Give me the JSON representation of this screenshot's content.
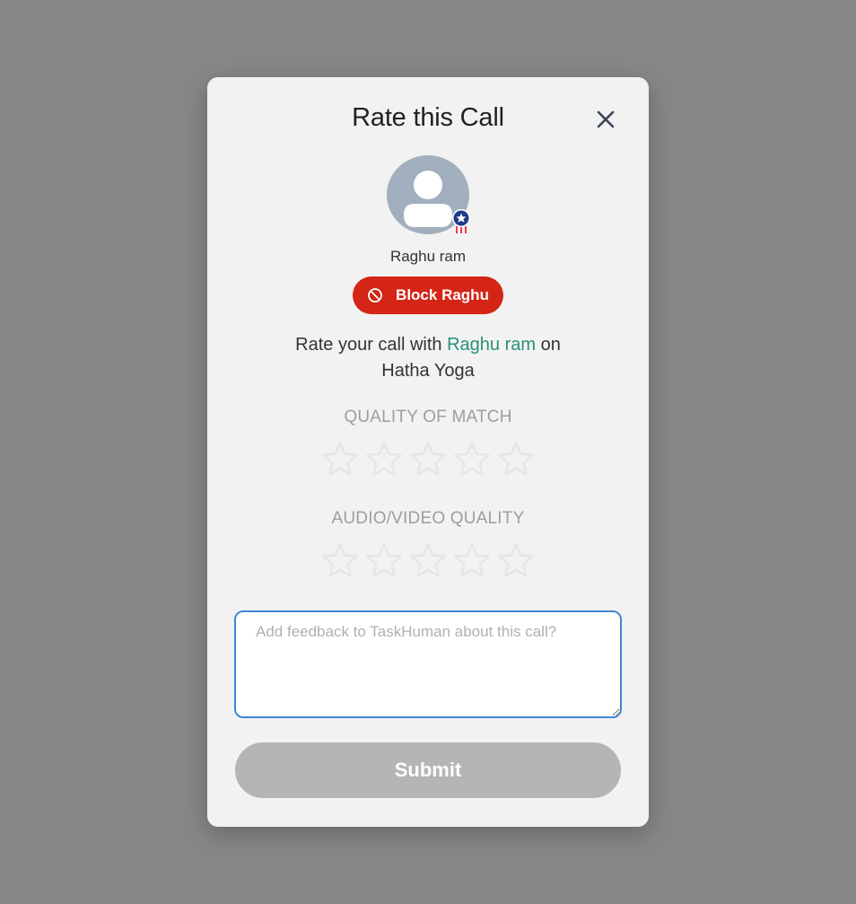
{
  "modal": {
    "title": "Rate this Call",
    "close_icon": "close-icon"
  },
  "user": {
    "name": "Raghu ram",
    "avatar_icon": "person-icon",
    "badge_icon": "star-medal-icon"
  },
  "block_button": {
    "label": "Block Raghu",
    "icon": "block-icon",
    "color": "#d42516"
  },
  "rate_prompt": {
    "prefix": "Rate your call with ",
    "user_link": "Raghu ram",
    "middle": " on",
    "topic": "Hatha Yoga"
  },
  "ratings": [
    {
      "label": "QUALITY OF MATCH",
      "value": 0,
      "max": 5
    },
    {
      "label": "AUDIO/VIDEO QUALITY",
      "value": 0,
      "max": 5
    }
  ],
  "feedback": {
    "placeholder": "Add feedback to TaskHuman about this call?",
    "value": ""
  },
  "submit_button": {
    "label": "Submit"
  },
  "colors": {
    "backdrop": "#878787",
    "link": "#2a9178",
    "focus_border": "#3d88d2",
    "submit_disabled": "#b5b5b5"
  }
}
